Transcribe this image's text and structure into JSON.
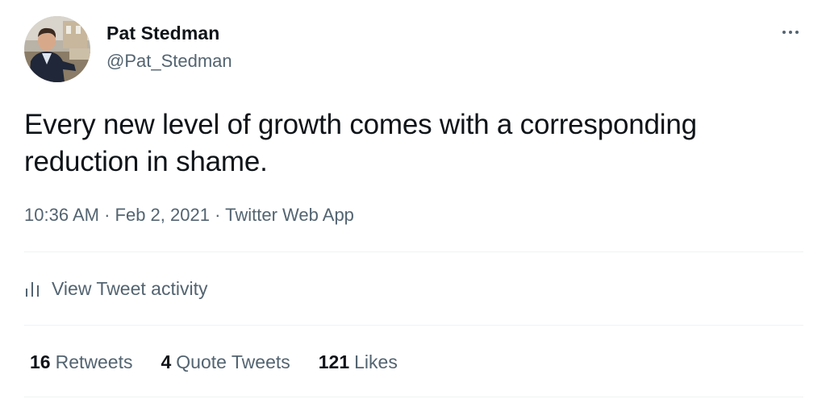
{
  "author": {
    "display_name": "Pat Stedman",
    "handle": "@Pat_Stedman",
    "avatar_icon": "profile-photo"
  },
  "tweet": {
    "text": "Every new level of growth comes with a corresponding reduction in shame.",
    "time": "10:36 AM",
    "separator": "·",
    "date": "Feb 2, 2021",
    "source": "Twitter Web App"
  },
  "more_icon": "more-horizontal-icon",
  "activity": {
    "icon": "bar-chart-icon",
    "label": "View Tweet activity"
  },
  "stats": {
    "retweets_count": "16",
    "retweets_label": "Retweets",
    "quotes_count": "4",
    "quotes_label": "Quote Tweets",
    "likes_count": "121",
    "likes_label": "Likes"
  },
  "colors": {
    "text_primary": "#0f1419",
    "text_secondary": "#536471",
    "divider": "#eff3f4",
    "background": "#ffffff"
  }
}
